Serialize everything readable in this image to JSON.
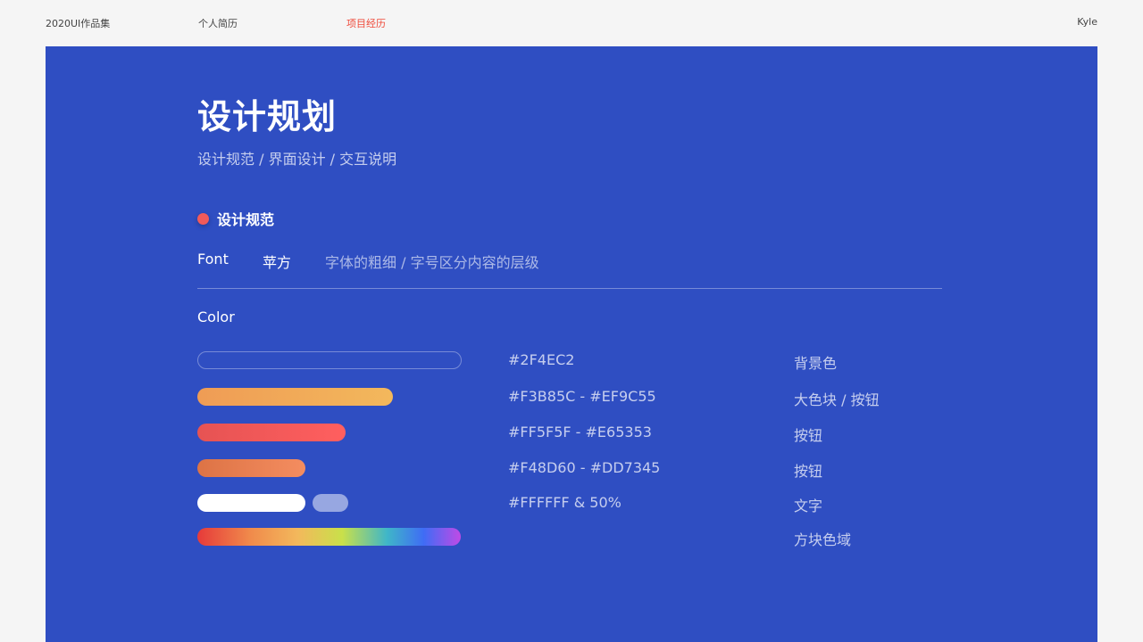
{
  "nav": {
    "brand": "2020UI作品集",
    "resume": "个人简历",
    "projects": "项目经历",
    "user": "Kyle"
  },
  "colors": {
    "background": "#f5f5f5",
    "panel": "#2f4ec2",
    "active_nav": "#ef4a3a",
    "bullet": "#f25a5a"
  },
  "panel": {
    "title": "设计规划",
    "subtitle": "设计规范 / 界面设计 / 交互说明",
    "section_title": "设计规范",
    "font": {
      "label": "Font",
      "name": "苹方",
      "description": "字体的粗细 / 字号区分内容的层级"
    },
    "color_label": "Color",
    "palette": [
      {
        "hex": "#2F4EC2",
        "usage": "背景色"
      },
      {
        "hex": "#F3B85C - #EF9C55",
        "usage": "大色块 / 按钮"
      },
      {
        "hex": "#FF5F5F - #E65353",
        "usage": "按钮"
      },
      {
        "hex": "#F48D60 - #DD7345",
        "usage": "按钮"
      },
      {
        "hex": "#FFFFFF & 50%",
        "usage": "文字"
      },
      {
        "hex": "",
        "usage": "方块色域"
      }
    ]
  }
}
